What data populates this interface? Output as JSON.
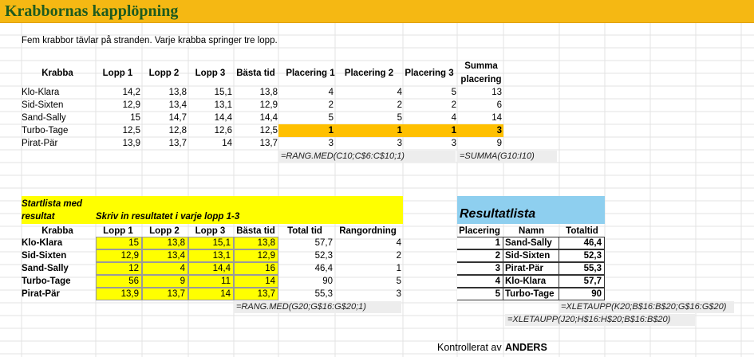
{
  "sheet": {
    "title": "Krabbornas kapplöpning",
    "intro": "Fem krabbor tävlar på stranden. Varje krabba springer tre lopp."
  },
  "top_table": {
    "headers": [
      "Krabba",
      "Lopp 1",
      "Lopp 2",
      "Lopp 3",
      "Bästa tid",
      "Placering 1",
      "Placering 2",
      "Placering 3",
      "Summa",
      "placering"
    ],
    "rows": [
      {
        "name": "Klo-Klara",
        "l1": "14,2",
        "l2": "13,8",
        "l3": "15,1",
        "best": "13,8",
        "p1": "4",
        "p2": "4",
        "p3": "5",
        "sum": "13"
      },
      {
        "name": "Sid-Sixten",
        "l1": "12,9",
        "l2": "13,4",
        "l3": "13,1",
        "best": "12,9",
        "p1": "2",
        "p2": "2",
        "p3": "2",
        "sum": "6"
      },
      {
        "name": "Sand-Sally",
        "l1": "15",
        "l2": "14,7",
        "l3": "14,4",
        "best": "14,4",
        "p1": "5",
        "p2": "5",
        "p3": "4",
        "sum": "14"
      },
      {
        "name": "Turbo-Tage",
        "l1": "12,5",
        "l2": "12,8",
        "l3": "12,6",
        "best": "12,5",
        "p1": "1",
        "p2": "1",
        "p3": "1",
        "sum": "3"
      },
      {
        "name": "Pirat-Pär",
        "l1": "13,9",
        "l2": "13,7",
        "l3": "14",
        "best": "13,7",
        "p1": "3",
        "p2": "3",
        "p3": "3",
        "sum": "9"
      }
    ],
    "formula_rank": "=RANG.MED(C10;C$6:C$10;1)",
    "formula_sum": "=SUMMA(G10:I10)"
  },
  "start_list": {
    "title_line1": "Startlista med",
    "title_line2": "resultat",
    "instruction": "Skriv in resultatet i varje lopp 1-3",
    "headers": [
      "Krabba",
      "Lopp 1",
      "Lopp 2",
      "Lopp 3",
      "Bästa tid",
      "Total tid",
      "Rangordning"
    ],
    "rows": [
      {
        "name": "Klo-Klara",
        "l1": "15",
        "l2": "13,8",
        "l3": "15,1",
        "best": "13,8",
        "total": "57,7",
        "rank": "4"
      },
      {
        "name": "Sid-Sixten",
        "l1": "12,9",
        "l2": "13,4",
        "l3": "13,1",
        "best": "12,9",
        "total": "52,3",
        "rank": "2"
      },
      {
        "name": "Sand-Sally",
        "l1": "12",
        "l2": "4",
        "l3": "14,4",
        "best": "16",
        "total": "46,4",
        "rank": "1"
      },
      {
        "name": "Turbo-Tage",
        "l1": "56",
        "l2": "9",
        "l3": "11",
        "best": "14",
        "total": "90",
        "rank": "5"
      },
      {
        "name": "Pirat-Pär",
        "l1": "13,9",
        "l2": "13,7",
        "l3": "14",
        "best": "13,7",
        "total": "55,3",
        "rank": "3"
      }
    ],
    "formula_rank": "=RANG.MED(G20;G$16:G$20;1)"
  },
  "result_list": {
    "title": "Resultatlista",
    "headers": [
      "Placering",
      "Namn",
      "Totaltid"
    ],
    "rows": [
      {
        "place": "1",
        "name": "Sand-Sally",
        "time": "46,4"
      },
      {
        "place": "2",
        "name": "Sid-Sixten",
        "time": "52,3"
      },
      {
        "place": "3",
        "name": "Pirat-Pär",
        "time": "55,3"
      },
      {
        "place": "4",
        "name": "Klo-Klara",
        "time": "57,7"
      },
      {
        "place": "5",
        "name": "Turbo-Tage",
        "time": "90"
      }
    ],
    "formula_time": "=XLETAUPP(K20;B$16:B$20;G$16:G$20)",
    "formula_name": "=XLETAUPP(J20;H$16:H$20;B$16:B$20)"
  },
  "footer": {
    "checked_label": "Kontrollerat av",
    "checked_by": "ANDERS"
  },
  "colors": {
    "title_bar": "#f5b813",
    "title_text": "#1e5b1e",
    "highlight_orange": "#ffc000",
    "input_yellow": "#ffff00",
    "result_header_blue": "#8ecfef",
    "formula_gray": "#ededed"
  }
}
